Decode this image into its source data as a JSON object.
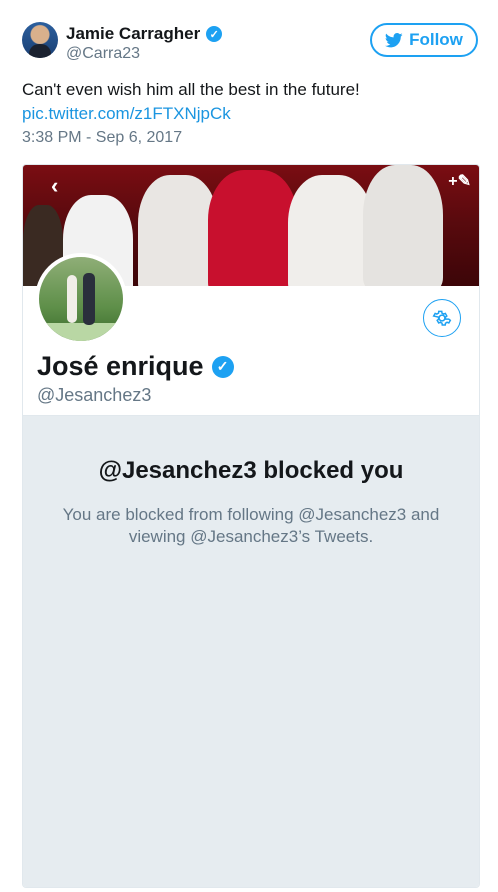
{
  "tweet": {
    "author_name": "Jamie Carragher",
    "author_handle": "@Carra23",
    "follow_label": "Follow",
    "text": "Can't even wish him all the best in the future!",
    "link": "pic.twitter.com/z1FTXNjpCk",
    "timestamp": "3:38 PM - Sep 6, 2017"
  },
  "embed": {
    "profile_name": "José enrique",
    "profile_handle": "@Jesanchez3",
    "blocked_title": "@Jesanchez3 blocked you",
    "blocked_description": "You are blocked from following @Jesanchez3 and viewing @Jesanchez3’s Tweets."
  },
  "colors": {
    "twitter_blue": "#1da1f2",
    "link_blue": "#1b95e0",
    "text_secondary": "#657786",
    "panel_bg": "#e6ecf0"
  },
  "icons": [
    "verified-badge-icon",
    "twitter-bird-icon",
    "gear-icon",
    "chevron-left-icon",
    "edit-plus-icon"
  ]
}
